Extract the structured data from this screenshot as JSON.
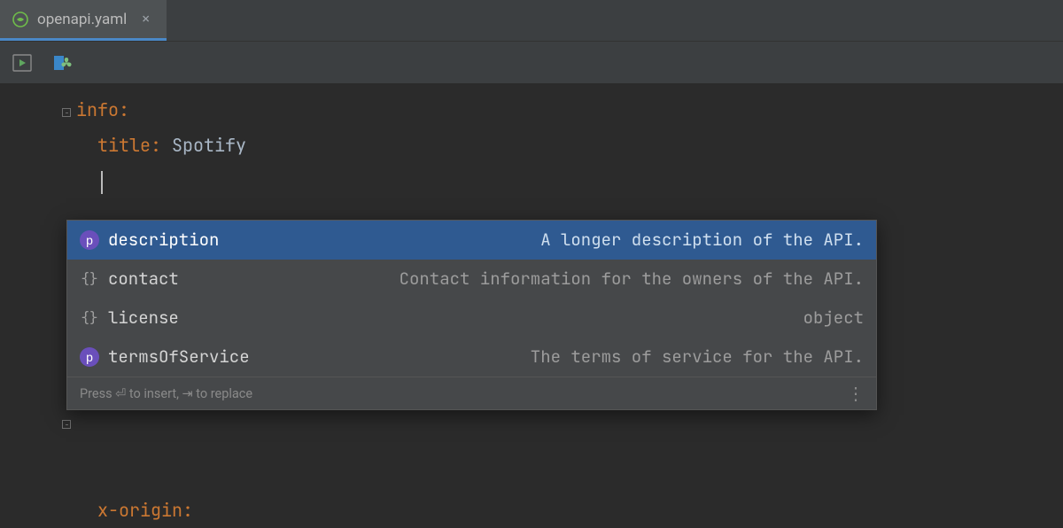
{
  "tab": {
    "filename": "openapi.yaml"
  },
  "code": {
    "lines": {
      "info_key": "info",
      "title_key": "title",
      "title_value": "Spotify",
      "x_origin_key": "x-origin"
    }
  },
  "completion": {
    "items": [
      {
        "kind": "p",
        "label": "description",
        "hint": "A longer description of the API."
      },
      {
        "kind": "braces",
        "label": "contact",
        "hint": "Contact information for the owners of the API."
      },
      {
        "kind": "braces",
        "label": "license",
        "hint": "object"
      },
      {
        "kind": "p",
        "label": "termsOfService",
        "hint": "The terms of service for the API."
      }
    ],
    "selected_index": 0,
    "footer": "Press ⏎ to insert, ⇥ to replace"
  }
}
